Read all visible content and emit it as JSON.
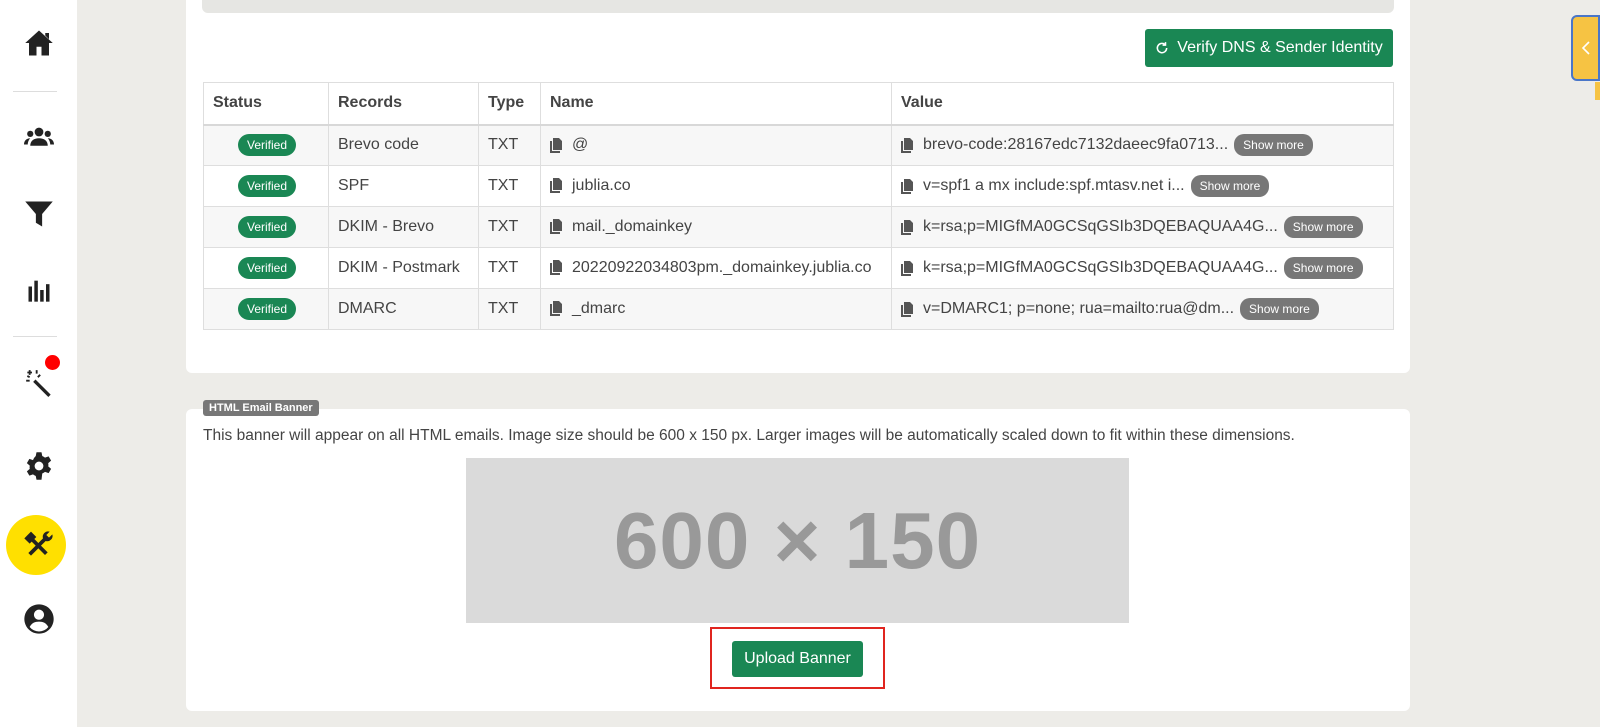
{
  "actions": {
    "verify_label": "Verify DNS & Sender Identity"
  },
  "table": {
    "headers": [
      "Status",
      "Records",
      "Type",
      "Name",
      "Value"
    ],
    "rows": [
      {
        "status": "Verified",
        "record": "Brevo code",
        "type": "TXT",
        "name": "@",
        "value": "brevo-code:28167edc7132daeec9fa0713...",
        "more": "Show more"
      },
      {
        "status": "Verified",
        "record": "SPF",
        "type": "TXT",
        "name": "jublia.co",
        "value": "v=spf1 a mx include:spf.mtasv.net i...",
        "more": "Show more"
      },
      {
        "status": "Verified",
        "record": "DKIM - Brevo",
        "type": "TXT",
        "name": "mail._domainkey",
        "value": "k=rsa;p=MIGfMA0GCSqGSIb3DQEBAQUAA4G...",
        "more": "Show more"
      },
      {
        "status": "Verified",
        "record": "DKIM - Postmark",
        "type": "TXT",
        "name": "20220922034803pm._domainkey.jublia.co",
        "value": "k=rsa;p=MIGfMA0GCSqGSIb3DQEBAQUAA4G...",
        "more": "Show more"
      },
      {
        "status": "Verified",
        "record": "DMARC",
        "type": "TXT",
        "name": "_dmarc",
        "value": "v=DMARC1; p=none; rua=mailto:rua@dm...",
        "more": "Show more"
      }
    ]
  },
  "banner": {
    "tag": "HTML Email Banner",
    "description": "This banner will appear on all HTML emails. Image size should be 600 x 150 px. Larger images will be automatically scaled down to fit within these dimensions.",
    "placeholder_text": "600 × 150",
    "upload_label": "Upload Banner"
  },
  "sidebar": {
    "items": [
      {
        "icon": "home-icon"
      },
      {
        "icon": "users-icon"
      },
      {
        "icon": "filter-icon"
      },
      {
        "icon": "bar-chart-icon"
      },
      {
        "icon": "magic-wand-icon",
        "notification": true
      },
      {
        "icon": "gear-icon"
      },
      {
        "icon": "tools-icon",
        "active": true
      },
      {
        "icon": "account-icon"
      }
    ]
  },
  "colors": {
    "primary": "#1a8754",
    "active_nav": "#ffe000",
    "notification": "#ff0000",
    "highlight": "#e0251f",
    "side_tab": "#f6c343"
  }
}
